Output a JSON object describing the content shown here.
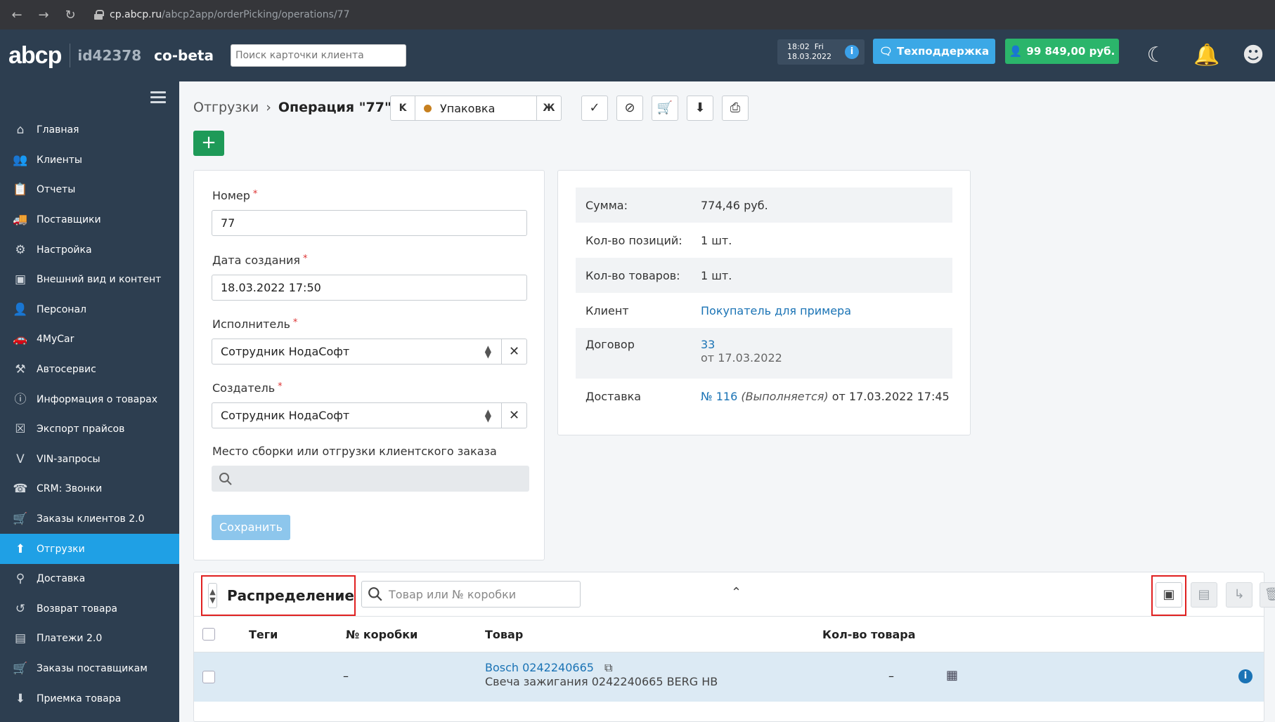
{
  "browser": {
    "url_host": "cp.abcp.ru",
    "url_path": "/abcp2app/orderPicking/operations/77"
  },
  "header": {
    "logo": "abcp",
    "account_id": "id42378",
    "account_name": "co-beta",
    "search_placeholder": "Поиск карточки клиента",
    "time": "18:02",
    "day": "Fri",
    "date": "18.03.2022",
    "support_label": "Техподдержка",
    "balance_label": "99 849,00 руб."
  },
  "sidebar": {
    "items": [
      {
        "label": "Главная",
        "icon": "home-icon"
      },
      {
        "label": "Клиенты",
        "icon": "users-icon"
      },
      {
        "label": "Отчеты",
        "icon": "clipboard-icon"
      },
      {
        "label": "Поставщики",
        "icon": "truck-icon"
      },
      {
        "label": "Настройка",
        "icon": "gear-icon"
      },
      {
        "label": "Внешний вид и контент",
        "icon": "image-icon"
      },
      {
        "label": "Персонал",
        "icon": "person-icon"
      },
      {
        "label": "4MyCar",
        "icon": "car-icon"
      },
      {
        "label": "Автосервис",
        "icon": "tools-icon"
      },
      {
        "label": "Информация о товарах",
        "icon": "info-icon"
      },
      {
        "label": "Экспорт прайсов",
        "icon": "excel-icon"
      },
      {
        "label": "VIN-запросы",
        "icon": "vin-icon"
      },
      {
        "label": "CRM: Звонки",
        "icon": "phone-icon"
      },
      {
        "label": "Заказы клиентов 2.0",
        "icon": "cart-icon"
      },
      {
        "label": "Отгрузки",
        "icon": "upload-icon",
        "active": true
      },
      {
        "label": "Доставка",
        "icon": "map-pin-icon"
      },
      {
        "label": "Возврат товара",
        "icon": "return-icon"
      },
      {
        "label": "Платежи 2.0",
        "icon": "wallet-icon"
      },
      {
        "label": "Заказы поставщикам",
        "icon": "cart-icon"
      },
      {
        "label": "Приемка товара",
        "icon": "download-icon"
      }
    ]
  },
  "breadcrumb": {
    "parent": "Отгрузки",
    "current": "Операция \"77\""
  },
  "status": {
    "prev_label": "K",
    "value": "Упаковка",
    "next_label": "Ж",
    "dot_color": "#c7801f"
  },
  "form": {
    "number_label": "Номер",
    "number_value": "77",
    "created_label": "Дата создания",
    "created_value": "18.03.2022 17:50",
    "executor_label": "Исполнитель",
    "executor_value": "Сотрудник НодаСофт",
    "creator_label": "Создатель",
    "creator_value": "Сотрудник НодаСофт",
    "place_label": "Место сборки или отгрузки клиентского заказа",
    "save_label": "Сохранить",
    "required_mark": "*"
  },
  "summary": {
    "sum_label": "Сумма:",
    "sum_value": "774,46 руб.",
    "positions_label": "Кол-во позиций:",
    "positions_value": "1 шт.",
    "goods_label": "Кол-во товаров:",
    "goods_value": "1 шт.",
    "client_label": "Клиент",
    "client_value": "Покупатель для примера",
    "contract_label": "Договор",
    "contract_number": "33",
    "contract_date": "от 17.03.2022",
    "delivery_label": "Доставка",
    "delivery_number": "№ 116",
    "delivery_status": "(Выполняется)",
    "delivery_date": "от 17.03.2022 17:45"
  },
  "distribution": {
    "title": "Распределение",
    "search_placeholder": "Товар или № коробки",
    "columns": {
      "tags": "Теги",
      "box": "№ коробки",
      "product": "Товар",
      "qty": "Кол-во товара"
    },
    "rows": [
      {
        "box": "–",
        "product_link": "Bosch 0242240665",
        "product_desc": "Свеча зажигания 0242240665 BERG HB",
        "qty": "–"
      }
    ]
  }
}
